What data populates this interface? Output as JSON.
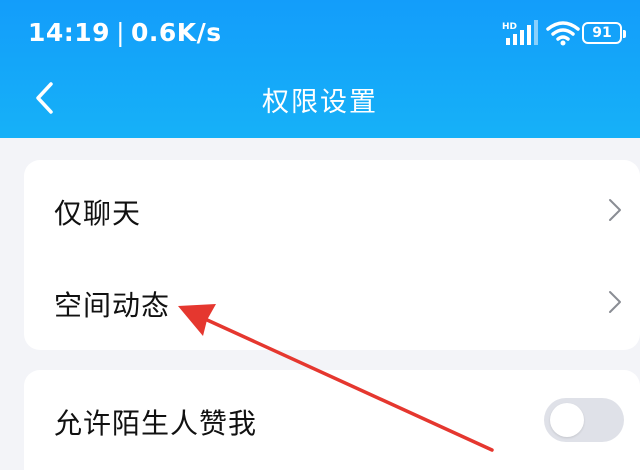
{
  "status_bar": {
    "time": "14:19",
    "separator": "|",
    "network_speed": "0.6K/s",
    "battery": "91",
    "signal_label": "HD",
    "icons": [
      "signal-icon",
      "wifi-icon",
      "battery-icon"
    ]
  },
  "navbar": {
    "title": "权限设置",
    "back_icon": "chevron-left-icon"
  },
  "settings": {
    "card1": [
      {
        "label": "仅聊天",
        "icon": "chevron-right-icon"
      },
      {
        "label": "空间动态",
        "icon": "chevron-right-icon"
      }
    ],
    "card2": [
      {
        "label": "允许陌生人赞我",
        "toggle_on": false
      }
    ]
  },
  "colors": {
    "header_blue": "#16a8f8",
    "background": "#f3f4f8",
    "toggle_off": "#dfe1e8",
    "annotation_red": "#e5372f"
  }
}
